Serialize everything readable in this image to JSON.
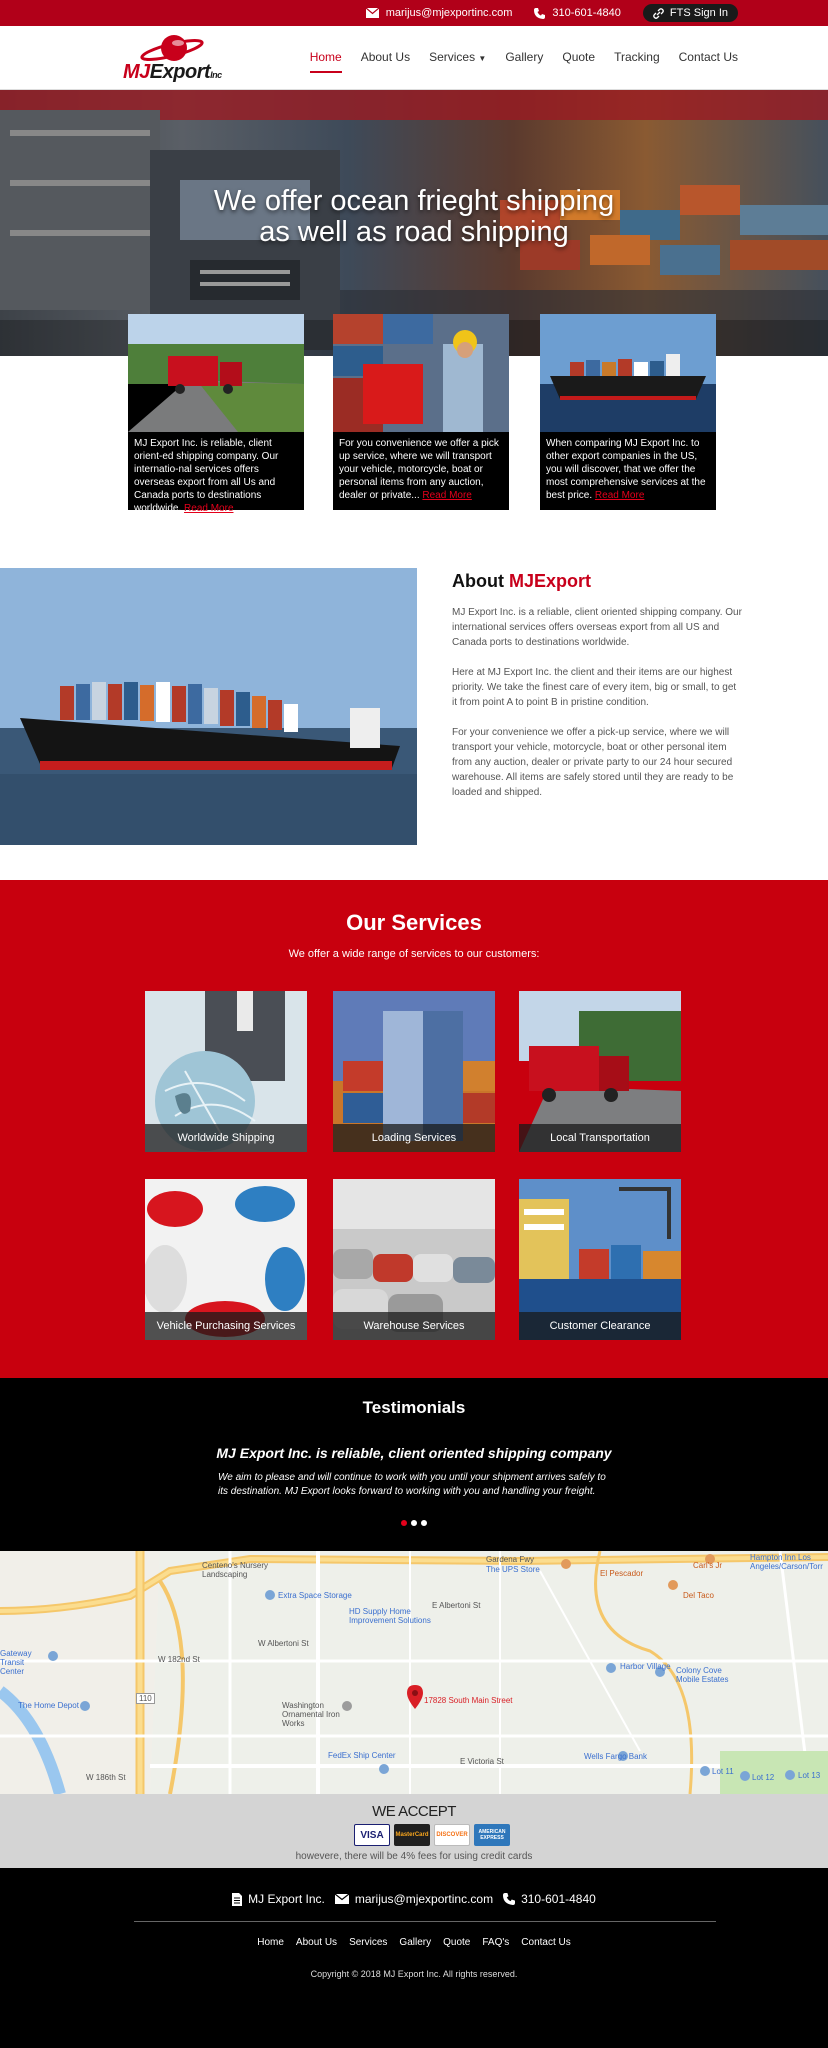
{
  "topbar": {
    "email": "marijus@mjexportinc.com",
    "phone": "310-601-4840",
    "signin": "FTS Sign In"
  },
  "logo": {
    "part1": "MJ",
    "part2": "Export",
    "suffix": "Inc"
  },
  "nav": {
    "items": [
      "Home",
      "About Us",
      "Services",
      "Gallery",
      "Quote",
      "Tracking",
      "Contact Us"
    ],
    "active": "Home"
  },
  "hero": {
    "line1": "We offer ocean frieght shipping",
    "line2": "as well as road shipping"
  },
  "features": [
    {
      "text": "MJ Export Inc. is reliable, client orient-ed shipping company. Our internatio-nal services offers overseas export from all Us and Canada ports to destinations worldwide.",
      "link": "Read More"
    },
    {
      "text": "For you convenience we offer a pick up service, where we will transport your vehicle, motorcycle, boat or personal items from any auction, dealer or private...",
      "link": "Read More"
    },
    {
      "text": "When comparing MJ Export Inc. to other export companies in the US, you will discover, that we offer the most comprehensive services at the best price.",
      "link": "Read More"
    }
  ],
  "about": {
    "title": "About ",
    "title_highlight": "MJExport",
    "paragraphs": [
      "MJ Export Inc. is a reliable, client oriented shipping company. Our international services offers overseas export from all US and Canada ports to destinations worldwide.",
      "Here at MJ Export Inc. the client and their items are our highest priority. We take the finest care of every item, big or small, to get it from point A to point B in pristine condition.",
      "For your convenience we offer a pick-up service, where we will transport your vehicle, motorcycle, boat or other personal item from any auction, dealer or private party to our 24 hour secured warehouse. All items are safely stored until they are ready to be loaded and shipped."
    ]
  },
  "services": {
    "title": "Our Services",
    "subtitle": "We offer a wide range of services to our customers:",
    "items": [
      "Worldwide Shipping",
      "Loading Services",
      "Local Transportation",
      "Vehicle Purchasing Services",
      "Warehouse Services",
      "Customer Clearance"
    ]
  },
  "testimonials": {
    "title": "Testimonials",
    "quote": "MJ Export Inc. is reliable, client oriented shipping company",
    "body": "We aim to please and will continue to work with you until your shipment arrives safely to its destination. MJ Export looks forward to working with you and handling your freight."
  },
  "map": {
    "address": "17828 South Main Street",
    "labels": {
      "centeno": "Centeno's Nursery Landscaping",
      "gardena": "Gardena Fwy",
      "ups": "The UPS Store",
      "pescador": "El Pescador",
      "carls": "Carl's Jr",
      "hampton": "Hampton Inn Los Angeles/Carson/Torr",
      "taco": "Del Taco",
      "extra": "Extra Space Storage",
      "hd": "HD Supply Home Improvement Solutions",
      "harbor": "Harbor Village",
      "colony": "Colony Cove Mobile Estates",
      "gateway": "Gateway Transit Center",
      "depot": "The Home Depot",
      "washington": "Washington Ornamental Iron Works",
      "fedex": "FedEx Ship Center",
      "wells": "Wells Fargo Bank",
      "lot11": "Lot 11",
      "lot12": "Lot 12",
      "lot13": "Lot 13",
      "victoria": "E Victoria St",
      "albertoni": "W Albertoni St",
      "albertoni_e": "E Albertoni St",
      "w182": "W 182nd St",
      "w186": "W 186th St",
      "i110": "110"
    }
  },
  "accept": {
    "title": "WE ACCEPT",
    "cards": [
      "VISA",
      "MasterCard",
      "DISCOVER",
      "AMERICAN EXPRESS"
    ],
    "note": "howevere, there will be 4% fees for using credit cards"
  },
  "footer": {
    "company": "MJ Export Inc.",
    "email": "marijus@mjexportinc.com",
    "phone": "310-601-4840",
    "links": [
      "Home",
      "About Us",
      "Services",
      "Gallery",
      "Quote",
      "FAQ's",
      "Contact Us"
    ],
    "copyright": "Copyright © 2018 MJ Export Inc. All rights reserved."
  },
  "colors": {
    "brand_red": "#c8000e",
    "topbar_red": "#b10019",
    "link_red": "#e4001b",
    "footer_black": "#000000"
  }
}
